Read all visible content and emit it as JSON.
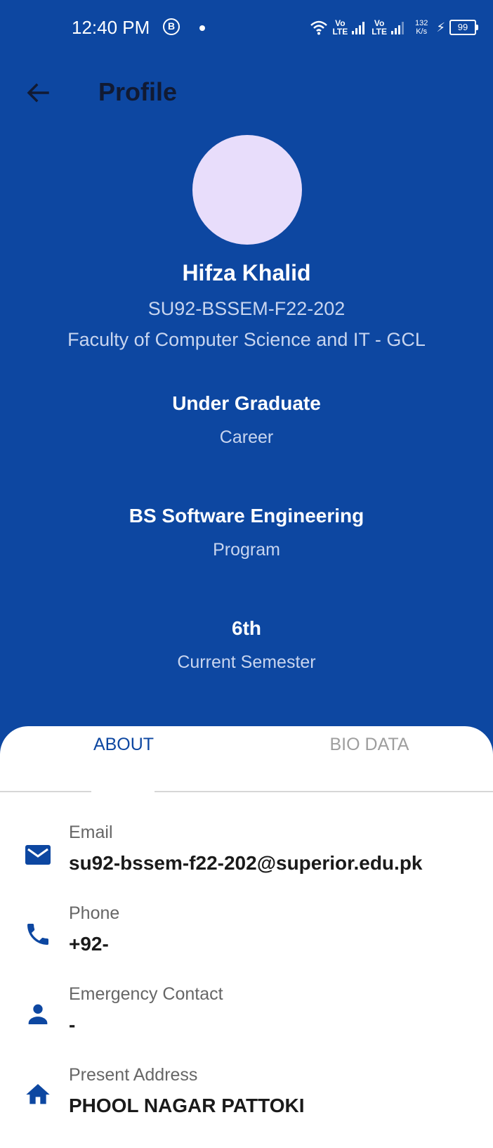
{
  "status_bar": {
    "time": "12:40 PM",
    "b_icon": "B",
    "lte1": "Vo\nLTE",
    "lte2": "Vo\nLTE",
    "speed_value": "132",
    "speed_unit": "K/s",
    "battery": "99"
  },
  "app_bar": {
    "title": "Profile",
    "back_icon": "arrow-left-icon"
  },
  "profile": {
    "name": "Hifza Khalid",
    "registration": "SU92-BSSEM-F22-202",
    "faculty": "Faculty of Computer Science and IT - GCL"
  },
  "summary": [
    {
      "value": "Under Graduate",
      "label": "Career"
    },
    {
      "value": "BS Software Engineering",
      "label": "Program"
    },
    {
      "value": "6th",
      "label": "Current Semester"
    }
  ],
  "tabs": [
    {
      "label": "ABOUT",
      "selected": true
    },
    {
      "label": "BIO DATA",
      "selected": false
    }
  ],
  "about": [
    {
      "icon": "email-icon",
      "label": "Email",
      "value": "su92-bssem-f22-202@superior.edu.pk"
    },
    {
      "icon": "phone-icon",
      "label": "Phone",
      "value": "+92-"
    },
    {
      "icon": "person-icon",
      "label": "Emergency Contact",
      "value": "-"
    },
    {
      "icon": "home-icon",
      "label": "Present Address",
      "value": "PHOOL NAGAR PATTOKI"
    }
  ],
  "colors": {
    "primary": "#0d47a1",
    "avatar": "#e8ddfb",
    "sheet": "#ffffff"
  }
}
